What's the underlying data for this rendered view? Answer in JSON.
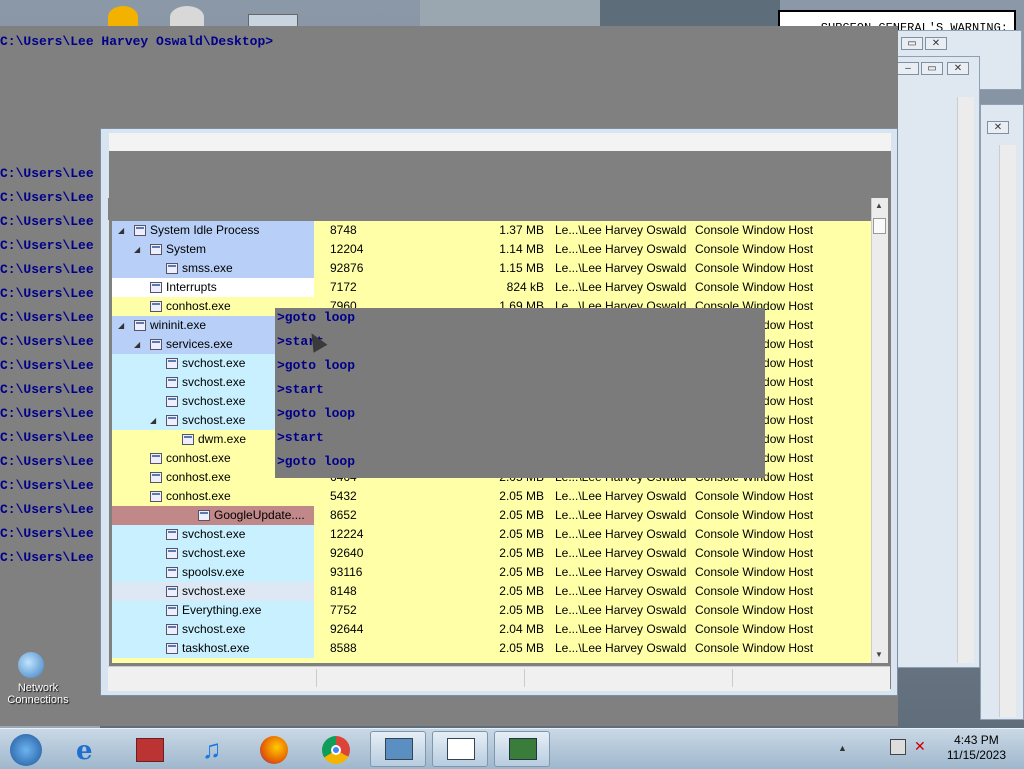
{
  "console": {
    "prompt_top": "C:\\Users\\Lee Harvey Oswald\\Desktop>",
    "lines": [
      "C:\\Users\\Lee Harvey Oswald\\Desktop>goto loop",
      "C:\\Users\\Lee Harvey Oswald\\Desktop>start",
      "C:\\Users\\Lee Harvey Oswald\\Desktop>goto loop",
      "C:\\Users\\Lee",
      "C:\\Users\\Lee",
      "C:\\Users\\Lee",
      "C:\\Users\\Lee",
      "C:\\Users\\Lee",
      "C:\\Users\\Lee",
      "C:\\Users\\Lee",
      "C:\\Users\\Lee",
      "C:\\Users\\Lee",
      "C:\\Users\\Lee",
      "C:\\Users\\Lee",
      "C:\\Users\\Lee",
      "C:\\Users\\Lee",
      "C:\\Users\\Lee"
    ],
    "overlay_lines": [
      ">goto loop",
      ">start",
      ">goto loop",
      ">start",
      ">goto loop",
      ">start",
      ">goto loop"
    ]
  },
  "warning_sign": {
    "text": "SURGEON GENERAL'S WARNING: Smoking Disease, ncy."
  },
  "process_list": {
    "rows": [
      {
        "name": "System Idle Process",
        "pid": "8748",
        "mem": "1.37 MB",
        "user": "Le...\\Lee Harvey Oswald",
        "desc": "Console Window Host",
        "indent": 1,
        "expander": "◢",
        "color": "#b8d0f8"
      },
      {
        "name": "System",
        "pid": "12204",
        "mem": "1.14 MB",
        "user": "Le...\\Lee Harvey Oswald",
        "desc": "Console Window Host",
        "indent": 2,
        "expander": "◢",
        "color": "#b8d0f8"
      },
      {
        "name": "smss.exe",
        "pid": "92876",
        "mem": "1.15 MB",
        "user": "Le...\\Lee Harvey Oswald",
        "desc": "Console Window Host",
        "indent": 3,
        "expander": "",
        "color": "#b8d0f8"
      },
      {
        "name": "Interrupts",
        "pid": "7172",
        "mem": "824 kB",
        "user": "Le...\\Lee Harvey Oswald",
        "desc": "Console Window Host",
        "indent": 2,
        "expander": "",
        "color": "#ffffff"
      },
      {
        "name": "conhost.exe",
        "pid": "7960",
        "mem": "1.69 MB",
        "user": "Le...\\Lee Harvey Oswald",
        "desc": "Console Window Host",
        "indent": 2,
        "expander": "",
        "color": "#ffffa8"
      },
      {
        "name": "wininit.exe",
        "pid": "",
        "mem": "",
        "user": "",
        "desc": "Console Window Host",
        "indent": 1,
        "expander": "◢",
        "color": "#b8d0f8"
      },
      {
        "name": "services.exe",
        "pid": "",
        "mem": "",
        "user": "",
        "desc": "Console Window Host",
        "indent": 2,
        "expander": "◢",
        "color": "#b8d0f8"
      },
      {
        "name": "svchost.exe",
        "pid": "",
        "mem": "",
        "user": "",
        "desc": "Console Window Host",
        "indent": 3,
        "expander": "",
        "color": "#c8f0ff"
      },
      {
        "name": "svchost.exe",
        "pid": "",
        "mem": "",
        "user": "",
        "desc": "Console Window Host",
        "indent": 3,
        "expander": "",
        "color": "#c8f0ff"
      },
      {
        "name": "svchost.exe",
        "pid": "",
        "mem": "",
        "user": "",
        "desc": "Console Window Host",
        "indent": 3,
        "expander": "",
        "color": "#c8f0ff"
      },
      {
        "name": "svchost.exe",
        "pid": "",
        "mem": "",
        "user": "",
        "desc": "Console Window Host",
        "indent": 3,
        "expander": "◢",
        "color": "#c8f0ff"
      },
      {
        "name": "dwm.exe",
        "pid": "",
        "mem": "",
        "user": "",
        "desc": "Console Window Host",
        "indent": 4,
        "expander": "",
        "color": "#ffffa8"
      },
      {
        "name": "conhost.exe",
        "pid": "",
        "mem": "",
        "user": "",
        "desc": "Console Window Host",
        "indent": 2,
        "expander": "",
        "color": "#ffffa8"
      },
      {
        "name": "conhost.exe",
        "pid": "6464",
        "mem": "2.05 MB",
        "user": "Le...\\Lee Harvey Oswald",
        "desc": "Console Window Host",
        "indent": 2,
        "expander": "",
        "color": "#ffffa8"
      },
      {
        "name": "conhost.exe",
        "pid": "5432",
        "mem": "2.05 MB",
        "user": "Le...\\Lee Harvey Oswald",
        "desc": "Console Window Host",
        "indent": 2,
        "expander": "",
        "color": "#ffffa8"
      },
      {
        "name": "GoogleUpdate....",
        "pid": "8652",
        "mem": "2.05 MB",
        "user": "Le...\\Lee Harvey Oswald",
        "desc": "Console Window Host",
        "indent": 5,
        "expander": "",
        "color": "#c08888"
      },
      {
        "name": "svchost.exe",
        "pid": "12224",
        "mem": "2.05 MB",
        "user": "Le...\\Lee Harvey Oswald",
        "desc": "Console Window Host",
        "indent": 3,
        "expander": "",
        "color": "#c8f0ff"
      },
      {
        "name": "svchost.exe",
        "pid": "92640",
        "mem": "2.05 MB",
        "user": "Le...\\Lee Harvey Oswald",
        "desc": "Console Window Host",
        "indent": 3,
        "expander": "",
        "color": "#c8f0ff"
      },
      {
        "name": "spoolsv.exe",
        "pid": "93116",
        "mem": "2.05 MB",
        "user": "Le...\\Lee Harvey Oswald",
        "desc": "Console Window Host",
        "indent": 3,
        "expander": "",
        "color": "#c8f0ff"
      },
      {
        "name": "svchost.exe",
        "pid": "8148",
        "mem": "2.05 MB",
        "user": "Le...\\Lee Harvey Oswald",
        "desc": "Console Window Host",
        "indent": 3,
        "expander": "",
        "color": "#dde8f4"
      },
      {
        "name": "Everything.exe",
        "pid": "7752",
        "mem": "2.05 MB",
        "user": "Le...\\Lee Harvey Oswald",
        "desc": "Console Window Host",
        "indent": 3,
        "expander": "",
        "color": "#c8f0ff"
      },
      {
        "name": "svchost.exe",
        "pid": "92644",
        "mem": "2.04 MB",
        "user": "Le...\\Lee Harvey Oswald",
        "desc": "Console Window Host",
        "indent": 3,
        "expander": "",
        "color": "#c8f0ff"
      },
      {
        "name": "taskhost.exe",
        "pid": "8588",
        "mem": "2.05 MB",
        "user": "Le...\\Lee Harvey Oswald",
        "desc": "Console Window Host",
        "indent": 3,
        "expander": "",
        "color": "#c8f0ff"
      }
    ]
  },
  "desktop": {
    "icon_label": "Network Connections"
  },
  "taskbar": {
    "time": "4:43 PM",
    "date": "11/15/2023"
  },
  "colors": {
    "console_bg": "#808080",
    "console_text": "#00008b",
    "proc_yellow": "#ffffa8",
    "proc_blue": "#b8d0f8",
    "proc_cyan": "#c8f0ff"
  }
}
